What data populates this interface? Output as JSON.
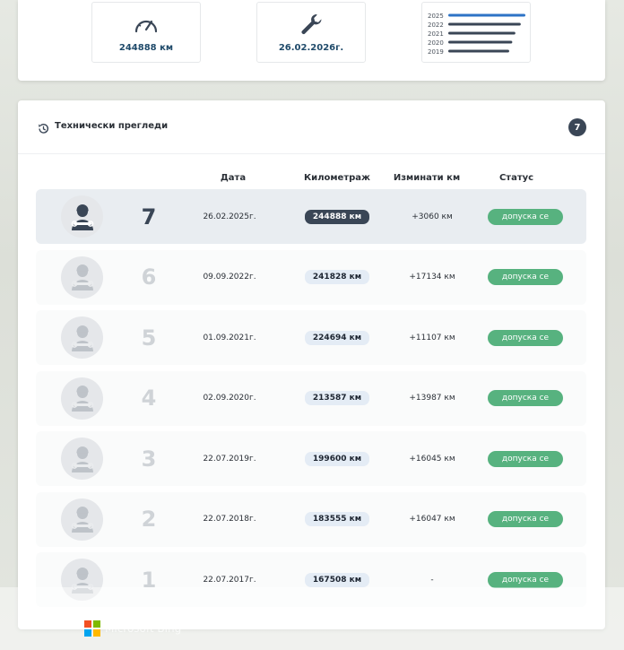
{
  "summary": {
    "mileage": "244888 км",
    "service_date": "26.02.2026г.",
    "year_chart": {
      "years": [
        "2025",
        "2022",
        "2021",
        "2020",
        "2019"
      ],
      "values": [
        100,
        94,
        87,
        83,
        79
      ],
      "colors": [
        "#2d73c6",
        "#3a4656",
        "#3a4656",
        "#3a4656",
        "#3a4656"
      ]
    }
  },
  "inspections": {
    "title": "Технически прегледи",
    "count": "7",
    "columns": {
      "date": "Дата",
      "mileage": "Километраж",
      "diff": "Изминати км",
      "status": "Статус"
    },
    "rows": [
      {
        "num": "7",
        "date": "26.02.2025г.",
        "km": "244888 км",
        "diff": "+3060 км",
        "status": "допуска се"
      },
      {
        "num": "6",
        "date": "09.09.2022г.",
        "km": "241828 км",
        "diff": "+17134 км",
        "status": "допуска се"
      },
      {
        "num": "5",
        "date": "01.09.2021г.",
        "km": "224694 км",
        "diff": "+11107 км",
        "status": "допуска се"
      },
      {
        "num": "4",
        "date": "02.09.2020г.",
        "km": "213587 км",
        "diff": "+13987 км",
        "status": "допуска се"
      },
      {
        "num": "3",
        "date": "22.07.2019г.",
        "km": "199600 км",
        "diff": "+16045 км",
        "status": "допуска се"
      },
      {
        "num": "2",
        "date": "22.07.2018г.",
        "km": "183555 км",
        "diff": "+16047 км",
        "status": "допуска се"
      },
      {
        "num": "1",
        "date": "22.07.2017г.",
        "km": "167508 км",
        "diff": "-",
        "status": "допуска се"
      }
    ]
  },
  "watermark": {
    "text": "Microsoft Bing"
  },
  "colors": {
    "accent": "#3a4656",
    "status_ok": "#57b27f",
    "pill_bg": "#e4ecf5",
    "brand_blue": "#1f4a6a"
  },
  "icons": {
    "mileage": "speedometer-icon",
    "service": "wrench-icon",
    "history": "history-clock-icon",
    "avatar": "mechanic-avatar-icon"
  }
}
